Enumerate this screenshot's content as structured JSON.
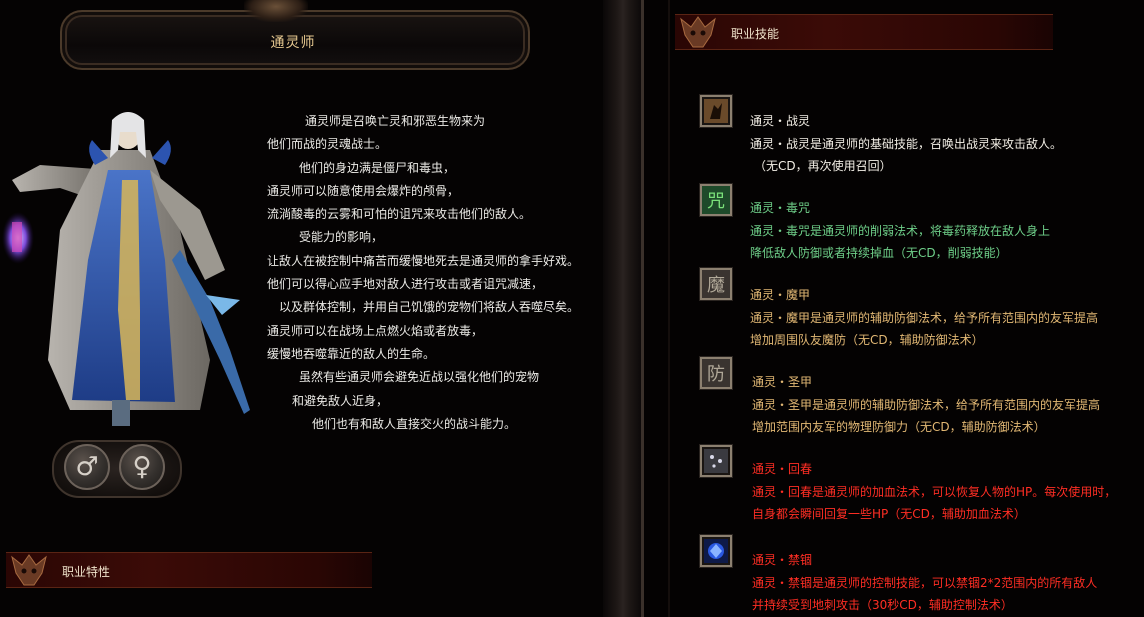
{
  "class_title": "通灵师",
  "description": [
    "通灵师是召唤亡灵和邪恶生物来为",
    "他们而战的灵魂战士。",
    "他们的身边满是僵尸和毒虫，",
    "通灵师可以随意使用会爆炸的颅骨，",
    "流淌酸毒的云雾和可怕的诅咒来攻击他们的敌人。",
    "受能力的影响，",
    "让敌人在被控制中痛苦而缓慢地死去是通灵师的拿手好戏。",
    "他们可以得心应手地对敌人进行攻击或者诅咒减速，",
    "以及群体控制，并用自己饥饿的宠物们将敌人吞噬尽矣。",
    "通灵师可以在战场上点燃火焰或者放毒，",
    "缓慢地吞噬靠近的敌人的生命。",
    "虽然有些通灵师会避免近战以强化他们的宠物",
    "和避免敌人近身，",
    "他们也有和敌人直接交火的战斗能力。"
  ],
  "gender": {
    "male_symbol": "♂",
    "female_symbol": "♀"
  },
  "sections": {
    "traits": "职业特性",
    "skills": "职业技能"
  },
  "skills": [
    {
      "name": "通灵・战灵",
      "lines": [
        "通灵・战灵是通灵师的基础技能，召唤出战灵来攻击敌人。",
        "（无CD，再次使用召回）"
      ],
      "color": "#f3efe6",
      "icon": "war-spirit-icon"
    },
    {
      "name": "通灵・毒咒",
      "lines": [
        "通灵・毒咒是通灵师的削弱法术，将毒药释放在敌人身上",
        "降低敌人防御或者持续掉血（无CD，削弱技能）"
      ],
      "color": "#6fd08a",
      "icon": "poison-curse-icon",
      "icon_glyph": "咒"
    },
    {
      "name": "通灵・魔甲",
      "lines": [
        "通灵・魔甲是通灵师的辅助防御法术，给予所有范围内的友军提高",
        "增加周围队友魔防（无CD，辅助防御法术）"
      ],
      "color": "#e2b874",
      "icon": "magic-armor-icon",
      "icon_glyph": "魔"
    },
    {
      "name": "通灵・圣甲",
      "lines": [
        "通灵・圣甲是通灵师的辅助防御法术，给予所有范围内的友军提高",
        "增加范围内友军的物理防御力（无CD，辅助防御法术）"
      ],
      "color": "#e2b874",
      "icon": "holy-armor-icon",
      "icon_glyph": "防"
    },
    {
      "name": "通灵・回春",
      "lines": [
        "通灵・回春是通灵师的加血法术，可以恢复人物的HP。每次使用时，",
        "自身都会瞬间回复一些HP（无CD，辅助加血法术）"
      ],
      "color": "#ff2e24",
      "icon": "rejuvenation-icon"
    },
    {
      "name": "通灵・禁锢",
      "lines": [
        "通灵・禁锢是通灵师的控制技能，可以禁锢2*2范围内的所有敌人",
        "并持续受到地刺攻击（30秒CD，辅助控制法术）"
      ],
      "color": "#ff2e24",
      "icon": "imprison-icon"
    }
  ]
}
